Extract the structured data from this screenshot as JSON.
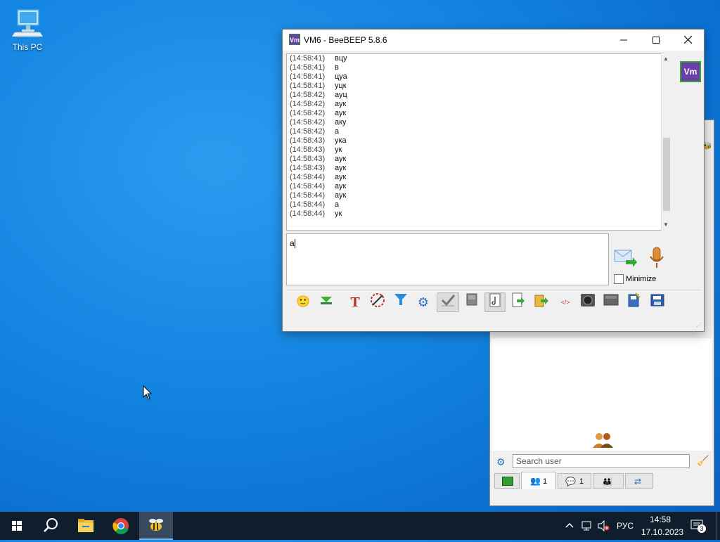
{
  "desktop": {
    "this_pc_label": "This PC"
  },
  "chat_window": {
    "title": "VM6 - BeeBEEP 5.8.6",
    "logo_text": "Vm",
    "buttons": {
      "minimize": "—",
      "maximize": "☐",
      "close": "✕"
    },
    "messages": [
      {
        "time": "(14:58:41)",
        "text": "вцу"
      },
      {
        "time": "(14:58:41)",
        "text": "в"
      },
      {
        "time": "(14:58:41)",
        "text": "цуа"
      },
      {
        "time": "(14:58:41)",
        "text": "уцк"
      },
      {
        "time": "(14:58:42)",
        "text": "ауц"
      },
      {
        "time": "(14:58:42)",
        "text": "аук"
      },
      {
        "time": "(14:58:42)",
        "text": "аук"
      },
      {
        "time": "(14:58:42)",
        "text": "аку"
      },
      {
        "time": "(14:58:42)",
        "text": "а"
      },
      {
        "time": "(14:58:43)",
        "text": "ука"
      },
      {
        "time": "(14:58:43)",
        "text": "ук"
      },
      {
        "time": "(14:58:43)",
        "text": "аук"
      },
      {
        "time": "(14:58:43)",
        "text": "аук"
      },
      {
        "time": "(14:58:44)",
        "text": "аук"
      },
      {
        "time": "(14:58:44)",
        "text": "аук"
      },
      {
        "time": "(14:58:44)",
        "text": "аук"
      },
      {
        "time": "(14:58:44)",
        "text": "а"
      },
      {
        "time": "(14:58:44)",
        "text": "ук"
      }
    ],
    "input_value": "а",
    "minimize_label": "Minimize",
    "avatar_text": "Vm",
    "toolbar_icons": [
      "smiley-icon",
      "ruler-icon",
      "font-icon",
      "color-icon",
      "filter-icon",
      "gear-icon",
      "spellcheck-icon",
      "dictionary-icon",
      "note-icon",
      "send-file-icon",
      "send-folder-icon",
      "html-icon",
      "screenshot-icon",
      "clear-icon",
      "save-icon",
      "save-as-icon"
    ]
  },
  "main_window": {
    "search_placeholder": "Search user",
    "tabs": [
      {
        "icon": "online-icon",
        "label": ""
      },
      {
        "icon": "users-icon",
        "label": "1"
      },
      {
        "icon": "chats-icon",
        "label": "1"
      },
      {
        "icon": "groups-icon",
        "label": ""
      },
      {
        "icon": "share-icon",
        "label": ""
      }
    ]
  },
  "taskbar": {
    "language": "РУС",
    "time": "14:58",
    "date": "17.10.2023",
    "notifications": "3"
  },
  "colors": {
    "desktop_blue": "#1486e2",
    "taskbar": "#0f1d2c",
    "vm_purple": "#6a3fa8"
  }
}
